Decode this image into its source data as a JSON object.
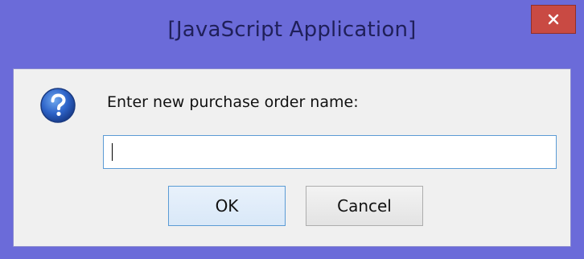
{
  "window": {
    "title": "[JavaScript Application]",
    "close_icon": "close-icon"
  },
  "dialog": {
    "icon": "question-icon",
    "prompt": "Enter new purchase order name:",
    "input_value": "",
    "ok_label": "OK",
    "cancel_label": "Cancel"
  },
  "colors": {
    "frame": "#6b6bd9",
    "close_button": "#c94a43",
    "client_bg": "#f0f0f0",
    "focus_border": "#5b9bd5"
  }
}
